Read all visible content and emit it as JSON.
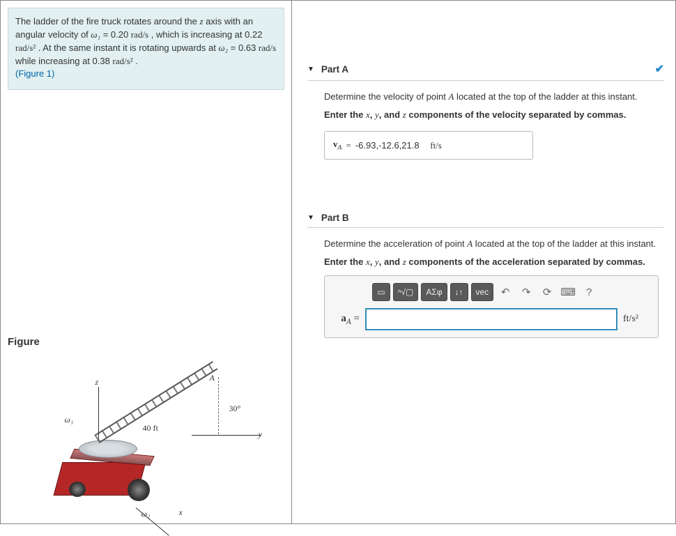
{
  "problem": {
    "text1": "The ladder of the fire truck rotates around the ",
    "axis": "z",
    "text2": " axis with an angular velocity of ",
    "w1var": "ω₁",
    "w1val": " = 0.20 ",
    "w1unit": "rad/s",
    "text3": " , which is increasing at 0.22 ",
    "accunit": "rad/s²",
    "text4": " . At the same instant it is rotating upwards at ",
    "w2var": "ω₂",
    "w2val": " = 0.63 ",
    "w2unit": "rad/s",
    "text5": " while increasing at 0.38 ",
    "accunit2": "rad/s²",
    "text6": " .",
    "figref": "(Figure 1)"
  },
  "figure": {
    "title": "Figure",
    "label_z": "z",
    "label_y": "y",
    "label_x": "x",
    "label_A": "A",
    "label_w1": "ω₁",
    "label_w2": "ω₂",
    "label_angle": "30°",
    "label_len": "40 ft"
  },
  "partA": {
    "title": "Part A",
    "instruct1_a": "Determine the velocity of point ",
    "instruct1_pt": "A",
    "instruct1_b": " located at the top of the ladder at this instant.",
    "instruct2_a": "Enter the ",
    "x": "x",
    "c1": ", ",
    "y": "y",
    "c2": ", and ",
    "z": "z",
    "instruct2_b": " components of the velocity separated by commas.",
    "var_pre": "v",
    "var_sub": "A",
    "eq": " = ",
    "value": "-6.93,-12.6,21.8",
    "unit": "ft/s",
    "correct": true
  },
  "partB": {
    "title": "Part B",
    "instruct1_a": "Determine the acceleration of point ",
    "instruct1_pt": "A",
    "instruct1_b": " located at the top of the ladder at this instant.",
    "instruct2_a": "Enter the ",
    "x": "x",
    "c1": ", ",
    "y": "y",
    "c2": ", and ",
    "z": "z",
    "instruct2_b": " components of the acceleration separated by commas.",
    "var_pre": "a",
    "var_sub": "A",
    "eq": " = ",
    "value": "",
    "unit": "ft/s²",
    "tool_sqrt": "ⁿ√▢",
    "tool_greek": "ΑΣφ",
    "tool_arrows": "↓↑",
    "tool_vec": "vec",
    "tool_help": "?"
  }
}
